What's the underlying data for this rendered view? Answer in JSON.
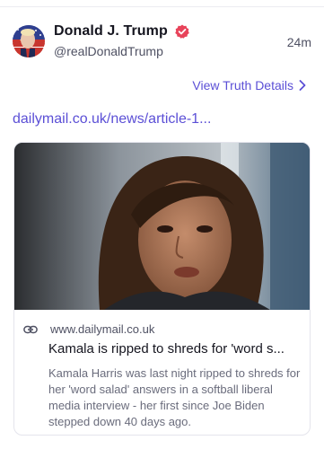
{
  "post": {
    "display_name": "Donald J. Trump",
    "handle": "@realDonaldTrump",
    "timestamp": "24m",
    "view_details_label": "View Truth Details",
    "link_text": "dailymail.co.uk/news/article-1...",
    "verified_color": "#e8435a",
    "accent_color": "#5b4fd6"
  },
  "card": {
    "domain": "www.dailymail.co.uk",
    "title": "Kamala is ripped to shreds for 'word s...",
    "description": "Kamala Harris was last night ripped to shreds for her 'word salad' answers in a softball liberal media interview - her first since Joe Biden stepped down 40 days ago."
  },
  "icons": {
    "verified": "verified-badge-icon",
    "chevron": "chevron-right-icon",
    "link": "link-icon"
  }
}
